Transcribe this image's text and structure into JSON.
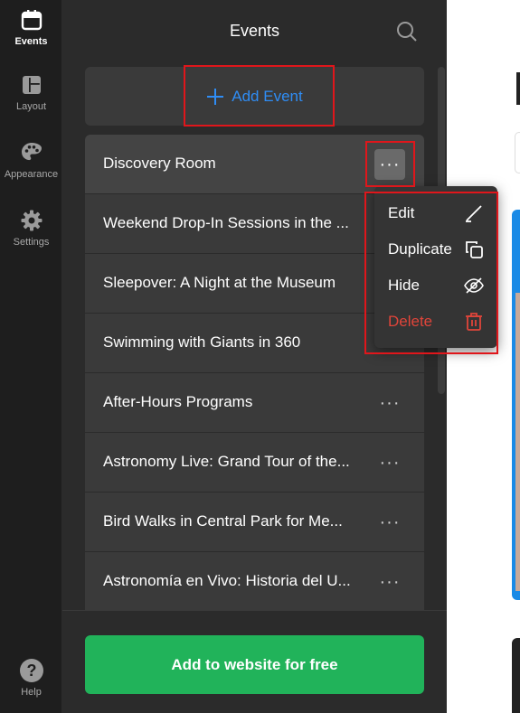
{
  "rail": {
    "items": [
      {
        "label": "Events",
        "icon": "calendar-icon"
      },
      {
        "label": "Layout",
        "icon": "layout-icon"
      },
      {
        "label": "Appearance",
        "icon": "palette-icon"
      },
      {
        "label": "Settings",
        "icon": "gear-icon"
      }
    ],
    "help": {
      "label": "Help",
      "icon": "help-icon",
      "glyph": "?"
    }
  },
  "panel": {
    "title": "Events",
    "add_event_label": "Add Event",
    "dots_glyph": "···",
    "events": [
      "Discovery Room",
      "Weekend Drop-In Sessions in the ...",
      "Sleepover: A Night at the Museum",
      "Swimming with Giants in 360",
      "After-Hours Programs",
      "Astronomy Live: Grand Tour of the...",
      "Bird Walks in Central Park for Me...",
      "Astronomía en Vivo: Historia del U..."
    ],
    "cta_label": "Add to website for free"
  },
  "menu": {
    "items": [
      {
        "label": "Edit",
        "icon": "pencil-icon"
      },
      {
        "label": "Duplicate",
        "icon": "duplicate-icon"
      },
      {
        "label": "Hide",
        "icon": "eye-off-icon"
      },
      {
        "label": "Delete",
        "icon": "trash-icon"
      }
    ]
  },
  "colors": {
    "accent_blue": "#2f8df5",
    "cta_green": "#21b35a",
    "danger_red": "#e0453a",
    "highlight_red": "#e0161b"
  }
}
